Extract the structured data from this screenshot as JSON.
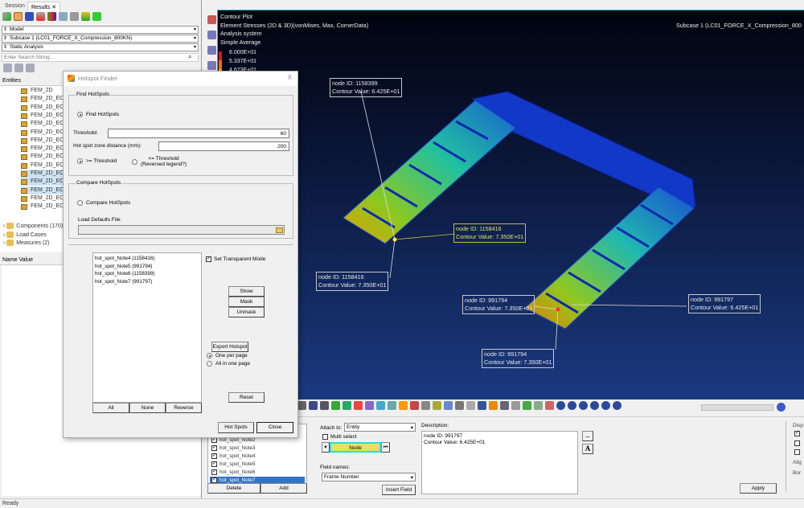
{
  "left_panel": {
    "tabs": [
      {
        "label": "Session"
      },
      {
        "label": "Results"
      }
    ],
    "tab_close": "✕",
    "model_select": "Model",
    "subcase_select": "Subcase 1 (LC01_FORCE_X_Compression_800KN)",
    "analysis_select": "Static Analysis",
    "search_placeholder": "Enter Search String...",
    "entities_header": "Entities",
    "tree_items": [
      "FEM_2D",
      "FEM_2D_EC_",
      "FEM_2D_EC_",
      "FEM_2D_EC_",
      "FEM_2D_EC_",
      "FEM_2D_EC_",
      "FEM_2D_EC_",
      "FEM_2D_EC_",
      "FEM_2D_EC_",
      "FEM_2D_EC_",
      "FEM_2D_EC_",
      "FEM_2D_EC_",
      "FEM_2D_EC_",
      "FEM_2D_EC_",
      "FEM_2D_EC_"
    ],
    "selected_tree_indices": [
      10,
      11,
      12
    ],
    "groups": [
      {
        "label": "Components (170)"
      },
      {
        "label": "Load Cases"
      },
      {
        "label": "Measures (2)"
      }
    ],
    "name_value_header": "Name Value"
  },
  "status_bar": {
    "text": "Ready"
  },
  "viewport": {
    "title_lines": [
      "Contour Plot",
      "Element Stresses (2D & 3D)(vonMises, Max, CornerData)",
      "Analysis system",
      "Simple Average"
    ],
    "subcase": "Subcase 1 (LC01_FORCE_X_Compression_800",
    "legend": [
      {
        "value": "6.000E+01",
        "color": "#ee1010"
      },
      {
        "value": "5.337E+01",
        "color": "#ff6a00"
      },
      {
        "value": "4.673E+01",
        "color": "#ffb000"
      }
    ],
    "callouts": [
      {
        "line1": "node ID: 1158399",
        "line2": "Contour Value: 6.425E+01"
      },
      {
        "line1": "node ID: 1158416",
        "line2": "Contour Value: 7.350E+01"
      },
      {
        "line1": "node ID: 1158416",
        "line2": "Contour Value: 7.350E+01"
      },
      {
        "line1": "node ID: 991794",
        "line2": "Contour Value: 7.350E+01"
      },
      {
        "line1": "node ID: 991797",
        "line2": "Contour Value: 6.425E+01"
      },
      {
        "line1": "node ID: 991794",
        "line2": "Contour Value: 7.350E+01"
      }
    ]
  },
  "dialog": {
    "title": "Hotspot Finder",
    "close": "X",
    "find_group": "Find HotSpots",
    "find_radio": "Find HotSpots",
    "threshold_label": "Threshold:",
    "threshold_value": "60",
    "zone_label": "Hot spot zone distance (mm):",
    "zone_value": "200",
    "ge_threshold": ">= Threshold",
    "le_threshold_1": "<= Threshold",
    "le_threshold_2": "(Reversed legend?)",
    "compare_group": "Compare HotSpots",
    "compare_radio": "Compare HotSpots",
    "load_defaults": "Load Defaults File:",
    "hotspots": [
      "hot_spot_Note4 (1158416)",
      "hot_spot_Note5 (991794)",
      "hot_spot_Note6 (1158399)",
      "hot_spot_Note7 (991797)"
    ],
    "transparent_mode": "Set Transparent Mode",
    "show": "Show",
    "mask": "Mask",
    "unmask": "Unmask",
    "export": "Export Hotspot",
    "one_per_page": "One per page",
    "all_in_one": "All in one page",
    "reset": "Reset",
    "all": "All",
    "none": "None",
    "reverse": "Reverse",
    "hot_spots_btn": "Hot Spots",
    "close_btn": "Close"
  },
  "notes_panel": {
    "notes": [
      "hot_spot_Note2",
      "hot_spot_Note3",
      "hot_spot_Note4",
      "hot_spot_Note5",
      "hot_spot_Note6",
      "hot_spot_Note7"
    ],
    "selected": "hot_spot_Note7",
    "delete": "Delete",
    "add": "Add",
    "attach_label": "Attach to:",
    "attach_value": "Entity",
    "multi_select": "Multi select",
    "node_btn": "Node",
    "field_names_label": "Field names:",
    "field_value": "Frame Number",
    "insert_field": "Insert Field",
    "description_label": "Description:",
    "description_lines": [
      "node ID: 991797",
      "Contour Value: 6.425E+01"
    ],
    "more_btn": "...",
    "font_btn": "A",
    "apply": "Apply",
    "right_labels": [
      "Disp",
      "Alig",
      "Bor"
    ]
  },
  "colors": {
    "viewport_top": "#02040e",
    "viewport_bottom": "#1a3a80",
    "accent": "#00c0d0",
    "selection": "#3373c8"
  }
}
